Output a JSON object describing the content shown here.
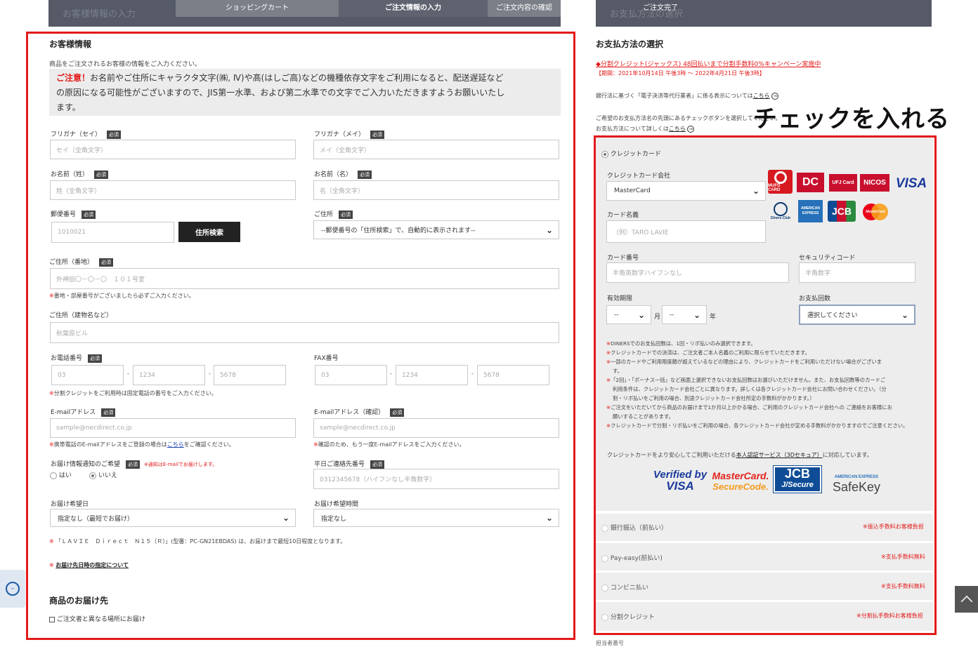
{
  "header": {
    "left_bg_title": "お客様情報の入力",
    "right_bg_title": "お支払方法の選択",
    "steps": [
      "ショッピングカート",
      "ご注文情報の入力",
      "ご注文内容の確認",
      "ご注文完了"
    ]
  },
  "customer": {
    "title": "お客様情報",
    "intro": "商品をご注文されるお客様の情報をご入力ください。",
    "warning_label": "ご注意！",
    "warning_line1": "お名前やご住所にキャラクタ文字(㈱, Ⅳ)や髙(はしご高)などの機種依存文字をご利用になると、配送遅延など",
    "warning_line2": "の原因になる可能性がございますので、JIS第一水準、および第二水準での文字でご入力いただきますようお願いいたし",
    "warning_line3": "ます。",
    "required_badge": "必須",
    "kana_sei_label": "フリガナ（セイ）",
    "kana_sei_ph": "セイ（全角文字）",
    "kana_mei_label": "フリガナ（メイ）",
    "kana_mei_ph": "メイ（全角文字）",
    "sei_label": "お名前（姓）",
    "sei_ph": "姓（全角文字）",
    "mei_label": "お名前（名）",
    "mei_ph": "名（全角文字）",
    "zip_label": "郵便番号",
    "zip_value": "1010021",
    "zip_button": "住所検索",
    "addr_label": "ご住所",
    "addr_select": "--郵便番号の「住所検索」で、自動的に表示されます--",
    "banchi_label": "ご住所（番地）",
    "banchi_ph": "外神田〇－〇－〇　１０１号室",
    "banchi_note": "番地・部屋番号がございましたら必ずご入力ください。",
    "building_label": "ご住所（建物名など）",
    "building_ph": "秋葉原ビル",
    "tel_label": "お電話番号",
    "tel_ph": [
      "03",
      "1234",
      "5678"
    ],
    "tel_note": "分割クレジットをご利用時は固定電話の番号をご入力ください。",
    "fax_label": "FAX番号",
    "fax_ph": [
      "03",
      "1234",
      "5678"
    ],
    "email_label": "E-mailアドレス",
    "email_ph": "sample@necdirect.co.jp",
    "email_note_pre": "携帯電話のE-mailアドレスをご登録の場合は",
    "email_note_link": "こちら",
    "email_note_post": "をご確認ください。",
    "email2_label": "E-mailアドレス（確認）",
    "email2_ph": "sample@necdirect.co.jp",
    "email2_note": "確認のため、もう一度E-mailアドレスをご入力ください。",
    "notify_label": "お届け情報通知のご希望",
    "notify_note": "※通知はE-mailでお届けします。",
    "notify_yes": "はい",
    "notify_no": "いいえ",
    "day_tel_label": "平日ご連絡先番号",
    "day_tel_ph": "0312345678（ハイフンなし半角数字）",
    "date_label": "お届け希望日",
    "date_select": "指定なし（最短でお届け）",
    "time_label": "お届け希望時間",
    "time_select": "指定なし",
    "lead_note": "「ＬＡＶＩＥ　Ｄｉｒｅｃｔ　Ｎ１５（Ｒ）」(型番：PC-GN21EBDAS) は、お届けまで最短10日程度となります。",
    "delivery_link": "お届け先日時の指定について",
    "ship_title": "商品のお届け先",
    "ship_check": "ご注文者と異なる場所にお届け"
  },
  "payment": {
    "title": "お支払方法の選択",
    "campaign": "◆分割クレジット(ジャックス) 48回払いまで分割手数料0%キャンペーン実施中",
    "campaign_period": "【期間：2021年10月14日 午後3時 ～ 2022年4月21日 午後3時】",
    "law_pre": "銀行法に基づく「電子決済等代行業者」に係る表示については",
    "law_link": "こちら",
    "choose_line1": "ご希望のお支払方法名の先頭にあるチェックボタンを選択してください。",
    "choose_line2_pre": "お支払方法について詳しくは",
    "choose_link": "こちら",
    "callout": "チェックを入れる",
    "credit_label": "クレジットカード",
    "card_company_label": "クレジットカード会社",
    "card_company_value": "MasterCard",
    "card_name_label": "カード名義",
    "card_name_ph": "（例）TARO LAVIE",
    "card_number_label": "カード番号",
    "card_number_ph": "半角英数字ハイフンなし",
    "security_label": "セキュリティコード",
    "security_ph": "半角数字",
    "expiry_label": "有効期限",
    "expiry_month": "--",
    "expiry_month_unit": "月",
    "expiry_year": "--",
    "expiry_year_unit": "年",
    "installments_label": "お支払回数",
    "installments_value": "選択してください",
    "notes": [
      "DINERSでのお支払回数は、1回・リボ払いのみ選択できます。",
      "クレジットカードでの決済は、ご注文者ご本人名義のご利用に限らせていただきます。",
      "一部のカードやご利用限度額が超えているなどの理由により、クレジットカードをご利用いただけない場合がございま",
      "す。",
      "「2回」・「ボーナス一括」など画面上選択できないお支払回数はお選びいただけません。また、お支払回数等のカードご",
      "利用条件は、クレジットカード会社ごとに異なります。詳しくは各クレジットカード会社にお問い合わせください。（分",
      "割・リボ払いをご利用の場合、別途クレジットカード会社所定の手数料がかかります。）",
      "ご注文をいただいてから商品のお届けまで1か月以上かかる場合、ご利用のクレジットカード会社への ご連絡をお客様にお",
      "願いすることがあります。",
      "クレジットカードで分割・リボ払いをご利用の場合、各クレジットカード会社が定める手数料がかかりますのでご注意ください。"
    ],
    "secure_pre": "クレジットカードをより安心してご利用いただける",
    "secure_link": "本人認証サービス（3Dセキュア）",
    "secure_post": "に対応しています。",
    "card_logos": [
      "MUFG CARD",
      "DC",
      "UFJ Card",
      "NICOS",
      "VISA",
      "Diners Club",
      "AMERICAN EXPRESS",
      "JCB",
      "MasterCard"
    ],
    "verified_visa": [
      "Verified by",
      "VISA"
    ],
    "mc_secure": [
      "MasterCard.",
      "SecureCode."
    ],
    "jcb_secure": [
      "JCB",
      "J/Secure"
    ],
    "safekey": [
      "AMERICAN EXPRESS",
      "SafeKey"
    ],
    "methods": [
      {
        "label": "銀行振込（前払い）",
        "fee": "※振込手数料お客様負担"
      },
      {
        "label": "Pay-easy(前払い)",
        "fee": "※支払手数料無料"
      },
      {
        "label": "コンビニ払い",
        "fee": "※支払手数料無料"
      },
      {
        "label": "分割クレジット",
        "fee": "※分割払手数料お客様負担"
      }
    ],
    "staff_label": "担当者番号"
  },
  "colors": {
    "accent_red": "#e31a1a",
    "bar": "#555a66"
  }
}
